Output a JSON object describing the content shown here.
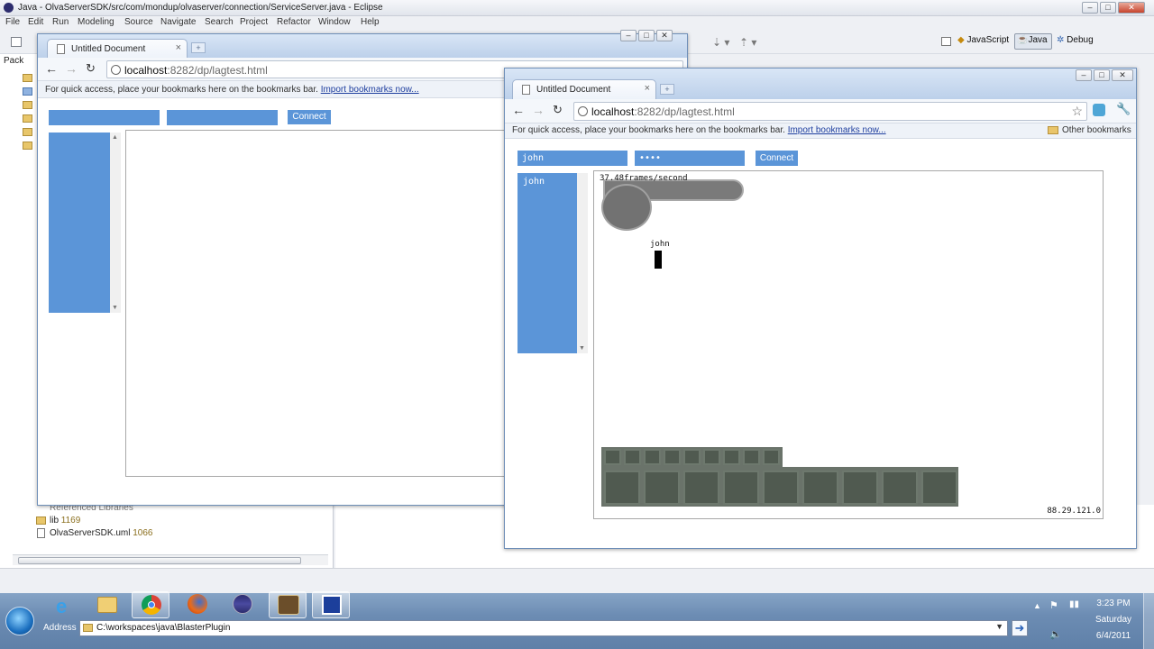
{
  "eclipse": {
    "title": "Java - OlvaServerSDK/src/com/mondup/olvaserver/connection/ServiceServer.java - Eclipse",
    "menu": [
      "File",
      "Edit",
      "Run",
      "Modeling",
      "Source",
      "Navigate",
      "Search",
      "Project",
      "Refactor",
      "Window",
      "Help"
    ],
    "perspectives": {
      "javascript": "JavaScript",
      "java": "Java",
      "debug": "Debug"
    },
    "package_tab": "Pack",
    "tree": {
      "referenced": "Referenced Libraries",
      "lib_name": "lib",
      "lib_rev": "1169",
      "uml_name": "OlvaServerSDK.uml",
      "uml_rev": "1066"
    }
  },
  "browser_back": {
    "tab_title": "Untitled Document",
    "url_host": "localhost",
    "url_path": ":8282/dp/lagtest.html",
    "bookmarks_text": "For quick access, place your bookmarks here on the bookmarks bar.",
    "import_link": "Import bookmarks now...",
    "connect_label": "Connect"
  },
  "browser_front": {
    "tab_title": "Untitled Document",
    "url_host": "localhost",
    "url_path": ":8282/dp/lagtest.html",
    "bookmarks_text": "For quick access, place your bookmarks here on the bookmarks bar.",
    "import_link": "Import bookmarks now...",
    "other_bookmarks": "Other bookmarks",
    "username_value": "john",
    "password_value": "••••",
    "connect_label": "Connect",
    "user_list": [
      "john"
    ],
    "game": {
      "fps_text": "37.48frames/second",
      "player_name": "john",
      "ip_text": "88.29.121.0",
      "top_slots": 9,
      "bottom_slots": 9
    }
  },
  "taskbar": {
    "address_label": "Address",
    "address_value": "C:\\workspaces\\java\\BlasterPlugin",
    "time": "3:23 PM",
    "day": "Saturday",
    "date": "6/4/2011",
    "apps": [
      "ie-icon",
      "explorer-icon",
      "chrome-icon",
      "firefox-icon",
      "eclipse-icon",
      "gimp-icon",
      "virtualbox-icon"
    ]
  },
  "colors": {
    "accent": "#5b95d8",
    "slot": "#505a50",
    "slot_border": "#6d786d"
  }
}
